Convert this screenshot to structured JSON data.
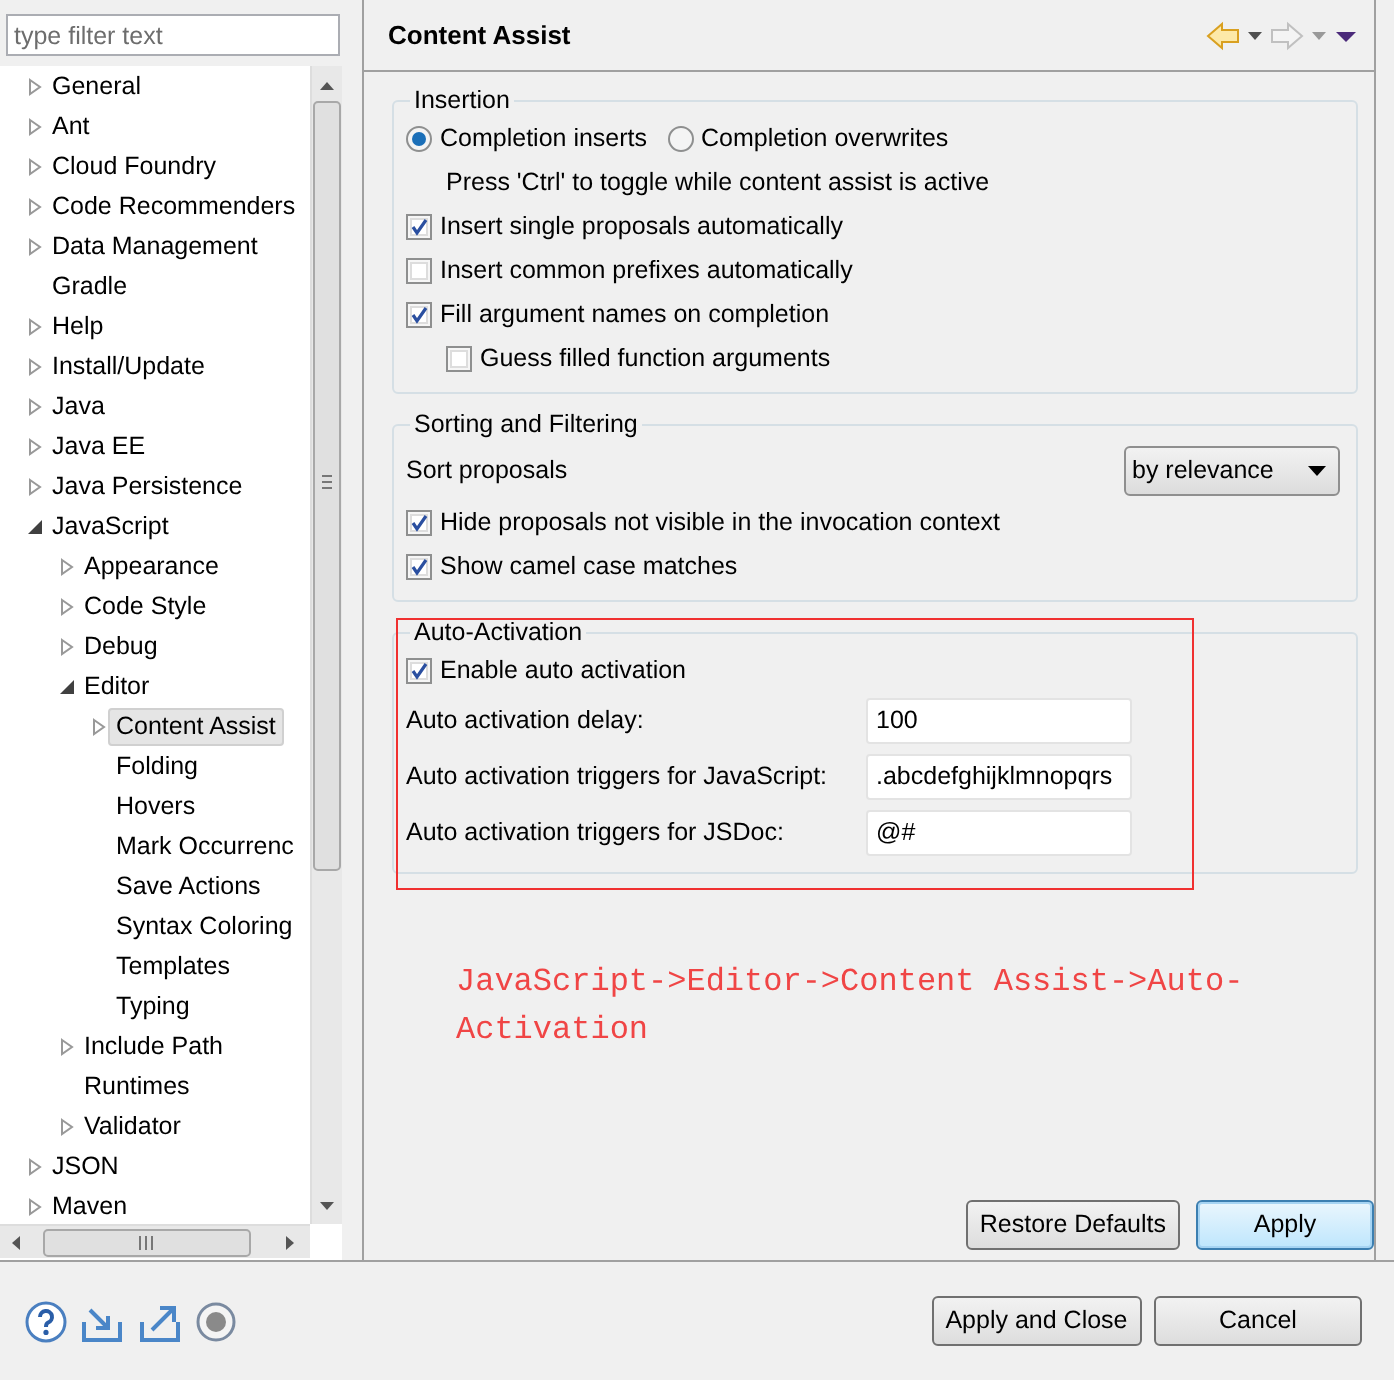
{
  "filter": {
    "placeholder": "type filter text"
  },
  "tree": [
    {
      "label": "General",
      "expandable": true,
      "expanded": false,
      "selected": false
    },
    {
      "label": "Ant",
      "expandable": true,
      "expanded": false,
      "selected": false
    },
    {
      "label": "Cloud Foundry",
      "expandable": true,
      "expanded": false,
      "selected": false
    },
    {
      "label": "Code Recommenders",
      "expandable": true,
      "expanded": false,
      "selected": false
    },
    {
      "label": "Data Management",
      "expandable": true,
      "expanded": false,
      "selected": false
    },
    {
      "label": "Gradle",
      "expandable": false,
      "selected": false
    },
    {
      "label": "Help",
      "expandable": true,
      "expanded": false,
      "selected": false
    },
    {
      "label": "Install/Update",
      "expandable": true,
      "expanded": false,
      "selected": false
    },
    {
      "label": "Java",
      "expandable": true,
      "expanded": false,
      "selected": false
    },
    {
      "label": "Java EE",
      "expandable": true,
      "expanded": false,
      "selected": false
    },
    {
      "label": "Java Persistence",
      "expandable": true,
      "expanded": false,
      "selected": false
    },
    {
      "label": "JavaScript",
      "expandable": true,
      "expanded": true,
      "selected": false,
      "children": [
        {
          "label": "Appearance",
          "expandable": true,
          "expanded": false,
          "selected": false
        },
        {
          "label": "Code Style",
          "expandable": true,
          "expanded": false,
          "selected": false
        },
        {
          "label": "Debug",
          "expandable": true,
          "expanded": false,
          "selected": false
        },
        {
          "label": "Editor",
          "expandable": true,
          "expanded": true,
          "selected": false,
          "children": [
            {
              "label": "Content Assist",
              "expandable": true,
              "expanded": false,
              "selected": true
            },
            {
              "label": "Folding",
              "expandable": false,
              "selected": false
            },
            {
              "label": "Hovers",
              "expandable": false,
              "selected": false
            },
            {
              "label": "Mark Occurrenc",
              "expandable": false,
              "selected": false
            },
            {
              "label": "Save Actions",
              "expandable": false,
              "selected": false
            },
            {
              "label": "Syntax Coloring",
              "expandable": false,
              "selected": false
            },
            {
              "label": "Templates",
              "expandable": false,
              "selected": false
            },
            {
              "label": "Typing",
              "expandable": false,
              "selected": false
            }
          ]
        },
        {
          "label": "Include Path",
          "expandable": true,
          "expanded": false,
          "selected": false
        },
        {
          "label": "Runtimes",
          "expandable": false,
          "selected": false
        },
        {
          "label": "Validator",
          "expandable": true,
          "expanded": false,
          "selected": false
        }
      ]
    },
    {
      "label": "JSON",
      "expandable": true,
      "expanded": false,
      "selected": false
    },
    {
      "label": "Maven",
      "expandable": true,
      "expanded": false,
      "selected": false
    }
  ],
  "page": {
    "title": "Content Assist",
    "back_enabled": true,
    "forward_enabled": false
  },
  "groups": [
    {
      "title": "Insertion",
      "highlighted": false,
      "items": [
        {
          "kind": "radios",
          "options": [
            {
              "label": "Completion inserts",
              "selected": true
            },
            {
              "label": "Completion overwrites",
              "selected": false
            }
          ]
        },
        {
          "kind": "note",
          "text": "Press 'Ctrl' to toggle while content assist is active"
        },
        {
          "kind": "checkbox",
          "label": "Insert single proposals automatically",
          "checked": true
        },
        {
          "kind": "checkbox",
          "label": "Insert common prefixes automatically",
          "checked": false
        },
        {
          "kind": "checkbox",
          "label": "Fill argument names on completion",
          "checked": true,
          "children": [
            {
              "kind": "checkbox",
              "label": "Guess filled function arguments",
              "checked": false
            }
          ]
        }
      ]
    },
    {
      "title": "Sorting and Filtering",
      "highlighted": false,
      "items": [
        {
          "kind": "select",
          "label": "Sort proposals",
          "value": "by relevance"
        },
        {
          "kind": "checkbox",
          "label": "Hide proposals not visible in the invocation context",
          "checked": true
        },
        {
          "kind": "checkbox",
          "label": "Show camel case matches",
          "checked": true
        }
      ]
    },
    {
      "title": "Auto-Activation",
      "highlighted": true,
      "items": [
        {
          "kind": "checkbox",
          "label": "Enable auto activation",
          "checked": true
        },
        {
          "kind": "field",
          "label": "Auto activation delay:",
          "value": "100"
        },
        {
          "kind": "field",
          "label": "Auto activation triggers for JavaScript:",
          "value": ".abcdefghijklmnopqrs"
        },
        {
          "kind": "field",
          "label": "Auto activation triggers for JSDoc:",
          "value": "@#"
        }
      ]
    }
  ],
  "annotation": {
    "text": "JavaScript->Editor->Content Assist->Auto-Activation"
  },
  "page_buttons": [
    {
      "label": "Restore Defaults",
      "default": false
    },
    {
      "label": "Apply",
      "default": true
    }
  ],
  "dialog_buttons": [
    {
      "label": "Apply and Close",
      "default": false
    },
    {
      "label": "Cancel",
      "default": false
    }
  ]
}
